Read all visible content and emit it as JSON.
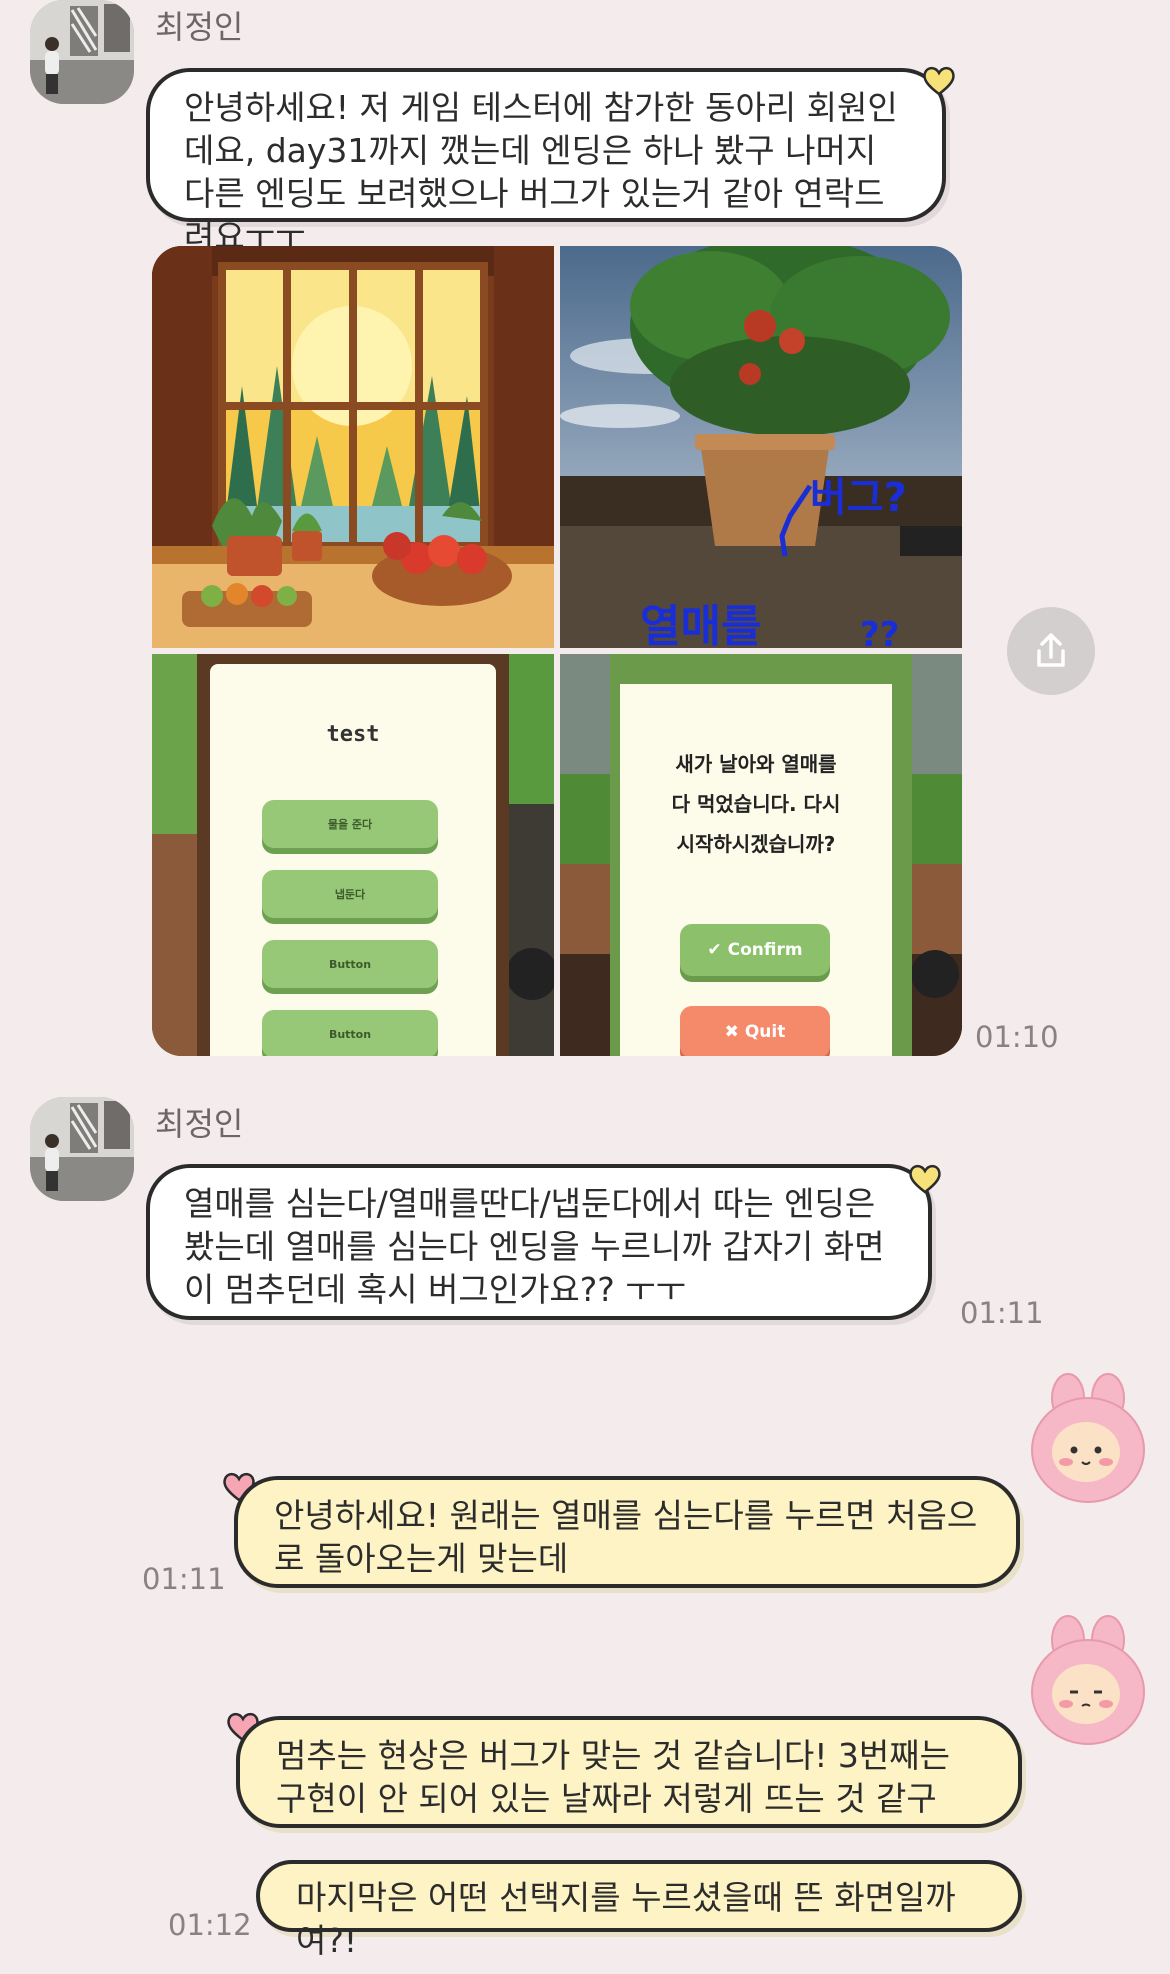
{
  "messages": {
    "m1": {
      "sender": "최정인",
      "text": "안녕하세요! 저 게임 테스터에 참가한 동아리 회원인데요, day31까지 깼는데 엔딩은 하나 봤구 나머지 다른 엔딩도 보려했으나 버그가 있는거 같아 연락드려요ㅜㅜ"
    },
    "photos": {
      "time": "01:10",
      "photo2_annotation_1": "버그?",
      "photo2_annotation_2": "열매를",
      "photo2_annotation_3": "??",
      "photo3": {
        "title": "test",
        "buttons": [
          "물을 준다",
          "냅둔다",
          "Button",
          "Button"
        ]
      },
      "photo4": {
        "dialog_line1": "새가 날아와 열매를",
        "dialog_line2": "다 먹었습니다. 다시",
        "dialog_line3": "시작하시겠습니까?",
        "confirm": "Confirm",
        "quit": "Quit"
      }
    },
    "m2": {
      "sender": "최정인",
      "text": "열매를 심는다/열매를딴다/냅둔다에서 따는 엔딩은 봤는데 열매를 심는다 엔딩을 누르니까 갑자기 화면이 멈추던데 혹시 버그인가요?? ㅜㅜ",
      "time": "01:11"
    },
    "m3": {
      "text": "안녕하세요! 원래는 열매를 심는다를 누르면 처음으로 돌아오는게 맞는데",
      "time": "01:11"
    },
    "m4": {
      "text": "멈추는 현상은 버그가 맞는 것 같습니다! 3번째는 구현이 안 되어 있는 날짜라 저렇게 뜨는 것 같구"
    },
    "m5": {
      "text": "마지막은 어떤 선택지를 누르셨을때 뜬 화면일까여?!",
      "time": "01:12"
    }
  },
  "colors": {
    "background": "#f4ecec",
    "incoming_bubble": "#ffffff",
    "outgoing_bubble": "#fdf3c4",
    "incoming_heart": "#f7e27a",
    "outgoing_heart": "#f6a5b5",
    "confirm_button": "#8cc06a",
    "quit_button": "#f58a6b"
  },
  "icons": {
    "share": "share-icon",
    "sticker": "pink-bunny-sticker"
  }
}
